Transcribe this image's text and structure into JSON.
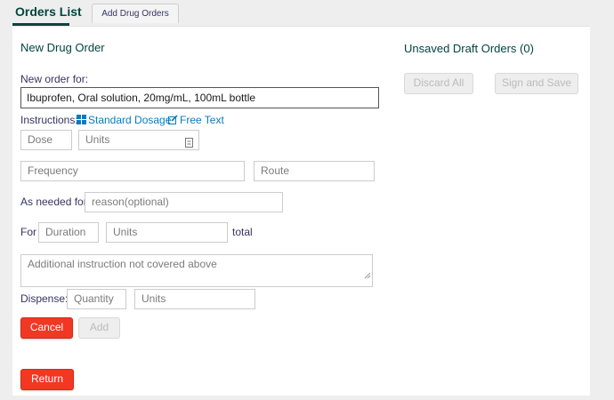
{
  "header": {
    "title": "Orders List",
    "tab_add_drug_orders": "Add Drug Orders"
  },
  "order_form": {
    "heading": "New Drug Order",
    "new_order_for_label": "New order for:",
    "drug_value": "Ibuprofen, Oral solution, 20mg/mL, 100mL bottle",
    "instructions_label": "Instructions:",
    "standard_dosage_link": "Standard Dosage",
    "free_text_link": "Free Text",
    "dose_placeholder": "Dose",
    "dose_units_placeholder": "Units",
    "frequency_placeholder": "Frequency",
    "route_placeholder": "Route",
    "as_needed_label": "As needed for",
    "reason_placeholder": "reason(optional)",
    "for_label": "For",
    "duration_placeholder": "Duration",
    "duration_units_placeholder": "Units",
    "total_label": "total",
    "additional_instruction_placeholder": "Additional instruction not covered above",
    "dispense_label": "Dispense:",
    "quantity_placeholder": "Quantity",
    "quantity_units_placeholder": "Units",
    "cancel_label": "Cancel",
    "add_label": "Add",
    "return_label": "Return"
  },
  "drafts": {
    "heading": "Unsaved Draft Orders (0)",
    "discard_all_label": "Discard All",
    "sign_and_save_label": "Sign and Save"
  },
  "colors": {
    "brand": "#00463f",
    "danger": "#f23722",
    "link": "#0a7bbf"
  }
}
